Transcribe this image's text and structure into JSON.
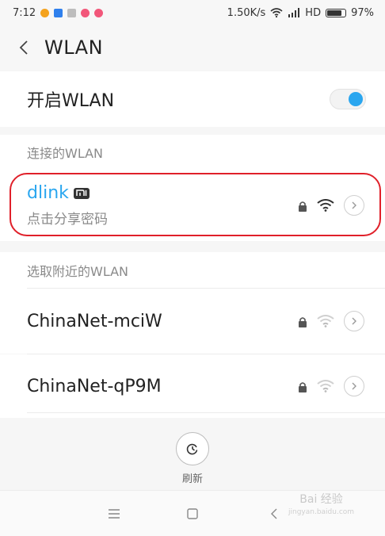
{
  "status_bar": {
    "time": "7:12",
    "speed": "1.50K/s",
    "network_type": "HD",
    "battery": "97%",
    "notification_colors": [
      "#f4a21d",
      "#2f80ed",
      "#bdbdbd",
      "#f2577a",
      "#f2577a"
    ]
  },
  "header": {
    "title": "WLAN",
    "back_icon": "chevron-left-icon"
  },
  "wlan_toggle": {
    "label": "开启WLAN",
    "enabled": true,
    "accent_color": "#2aa6ef"
  },
  "connected_section": {
    "header": "连接的WLAN",
    "network": {
      "name": "dlink",
      "subtitle": "点击分享密码",
      "name_color": "#2aa6ef",
      "badge_icon": "mi-logo-icon"
    }
  },
  "nearby_section": {
    "header": "选取附近的WLAN",
    "networks": [
      {
        "name": "ChinaNet-mciW"
      },
      {
        "name": "ChinaNet-qP9M"
      }
    ]
  },
  "refresh": {
    "label": "刷新"
  },
  "watermark": {
    "text": "Bai 经验",
    "sub": "jingyan.baidu.com"
  },
  "highlight_color": "#e0202a"
}
